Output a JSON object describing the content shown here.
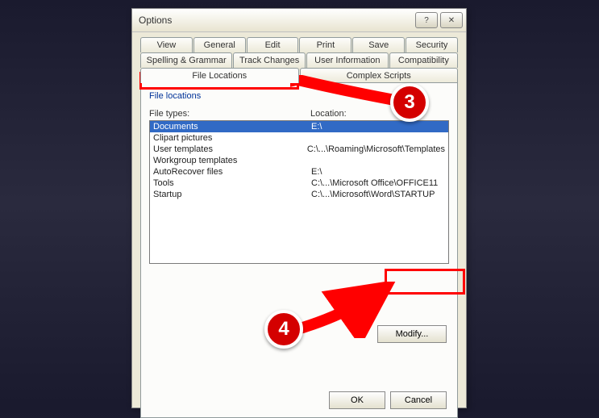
{
  "dialog": {
    "title": "Options"
  },
  "tabs": {
    "row1": [
      "View",
      "General",
      "Edit",
      "Print",
      "Save",
      "Security"
    ],
    "row2": [
      "Spelling & Grammar",
      "Track Changes",
      "User Information",
      "Compatibility"
    ],
    "row3": [
      "File Locations",
      "Complex Scripts"
    ]
  },
  "panel": {
    "section_title": "File locations",
    "col1": "File types:",
    "col2": "Location:",
    "rows": [
      {
        "type": "Documents",
        "loc": "E:\\",
        "selected": true
      },
      {
        "type": "Clipart pictures",
        "loc": ""
      },
      {
        "type": "User templates",
        "loc": "C:\\...\\Roaming\\Microsoft\\Templates"
      },
      {
        "type": "Workgroup templates",
        "loc": ""
      },
      {
        "type": "AutoRecover files",
        "loc": "E:\\"
      },
      {
        "type": "Tools",
        "loc": "C:\\...\\Microsoft Office\\OFFICE11"
      },
      {
        "type": "Startup",
        "loc": "C:\\...\\Microsoft\\Word\\STARTUP"
      }
    ],
    "modify_label": "Modify..."
  },
  "buttons": {
    "ok": "OK",
    "cancel": "Cancel"
  },
  "annotations": {
    "badge3": "3",
    "badge4": "4"
  }
}
